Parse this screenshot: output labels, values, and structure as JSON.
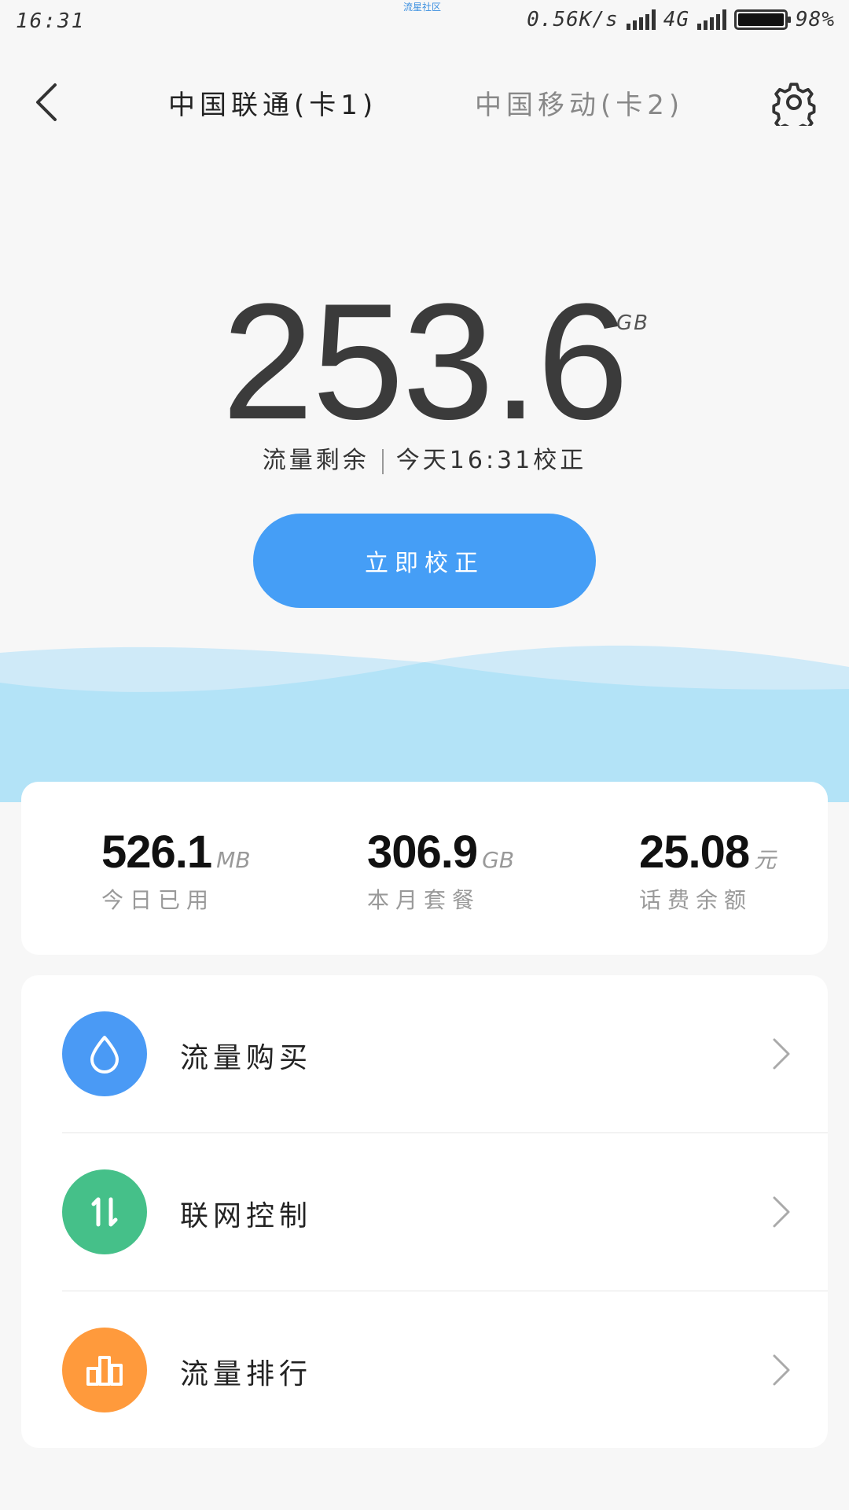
{
  "status_bar": {
    "time": "16:31",
    "brand": "流星社区",
    "net_speed": "0.56K/s",
    "network_type": "4G",
    "battery": "98%"
  },
  "header": {
    "tabs": [
      {
        "label": "中国联通(卡1)",
        "active": true
      },
      {
        "label": "中国移动(卡2)",
        "active": false
      }
    ]
  },
  "hero": {
    "remaining_value": "253.6",
    "remaining_unit": "GB",
    "remaining_label": "流量剩余",
    "calibrated_text": "今天16:31校正",
    "calibrate_button": "立即校正"
  },
  "stats": [
    {
      "value": "526.1",
      "unit": "MB",
      "label": "今日已用"
    },
    {
      "value": "306.9",
      "unit": "GB",
      "label": "本月套餐"
    },
    {
      "value": "25.08",
      "unit": "元",
      "label": "话费余额"
    }
  ],
  "menu": [
    {
      "label": "流量购买",
      "icon": "water-drop-icon",
      "color": "#4a9af5"
    },
    {
      "label": "联网控制",
      "icon": "up-down-arrows-icon",
      "color": "#45c089"
    },
    {
      "label": "流量排行",
      "icon": "bar-chart-icon",
      "color": "#ff9a3c"
    }
  ],
  "colors": {
    "accent": "#459ef6",
    "background": "#f7f7f7"
  }
}
